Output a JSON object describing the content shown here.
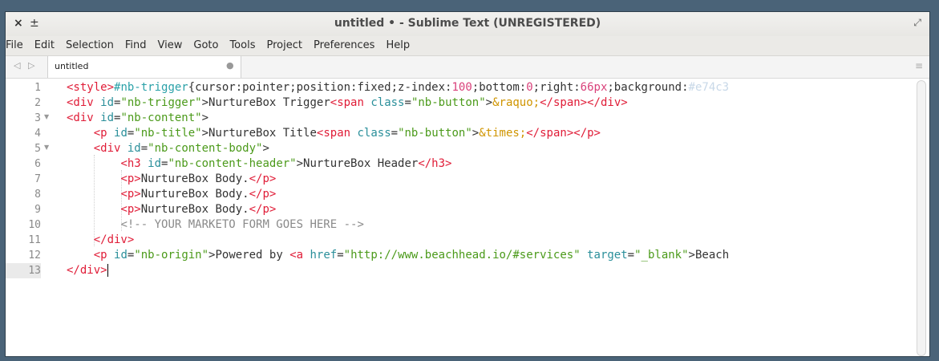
{
  "window": {
    "title": "untitled • - Sublime Text (UNREGISTERED)",
    "close_icon": "×",
    "pin_icon": "±",
    "expand_icon": "⤢"
  },
  "menu": [
    "File",
    "Edit",
    "Selection",
    "Find",
    "View",
    "Goto",
    "Tools",
    "Project",
    "Preferences",
    "Help"
  ],
  "tabs": {
    "arrows": "◁ ▷",
    "active_label": "untitled",
    "dirty_dot": "●",
    "menu_icon": "≡"
  },
  "editor": {
    "line_numbers": [
      "1",
      "2",
      "3",
      "4",
      "5",
      "6",
      "7",
      "8",
      "9",
      "10",
      "11",
      "12",
      "13"
    ],
    "lines": [
      [
        [
          "tag",
          "<style>"
        ],
        [
          "sel",
          "#nb-trigger"
        ],
        [
          "txt",
          "{cursor:pointer;position:fixed;z-index:"
        ],
        [
          "num",
          "100"
        ],
        [
          "txt",
          ";bottom:"
        ],
        [
          "num",
          "0"
        ],
        [
          "txt",
          ";right:"
        ],
        [
          "num",
          "66px"
        ],
        [
          "txt",
          ";background:"
        ],
        [
          "faint",
          "#e74c3"
        ]
      ],
      [
        [
          "tag",
          "<div "
        ],
        [
          "attr",
          "id"
        ],
        [
          "txt",
          "="
        ],
        [
          "str",
          "\"nb-trigger\""
        ],
        [
          "txt",
          ">NurtureBox Trigger"
        ],
        [
          "tag",
          "<span "
        ],
        [
          "attr",
          "class"
        ],
        [
          "txt",
          "="
        ],
        [
          "str",
          "\"nb-button\""
        ],
        [
          "txt",
          ">"
        ],
        [
          "ent",
          "&raquo;"
        ],
        [
          "tag",
          "</span>"
        ],
        [
          "tag",
          "</div>"
        ]
      ],
      [
        [
          "tag",
          "<div "
        ],
        [
          "attr",
          "id"
        ],
        [
          "txt",
          "="
        ],
        [
          "str",
          "\"nb-content\""
        ],
        [
          "txt",
          ">"
        ]
      ],
      [
        [
          "txt",
          "    "
        ],
        [
          "tag",
          "<p "
        ],
        [
          "attr",
          "id"
        ],
        [
          "txt",
          "="
        ],
        [
          "str",
          "\"nb-title\""
        ],
        [
          "txt",
          ">NurtureBox Title"
        ],
        [
          "tag",
          "<span "
        ],
        [
          "attr",
          "class"
        ],
        [
          "txt",
          "="
        ],
        [
          "str",
          "\"nb-button\""
        ],
        [
          "txt",
          ">"
        ],
        [
          "ent",
          "&times;"
        ],
        [
          "tag",
          "</span>"
        ],
        [
          "tag",
          "</p>"
        ]
      ],
      [
        [
          "txt",
          "    "
        ],
        [
          "tag",
          "<div "
        ],
        [
          "attr",
          "id"
        ],
        [
          "txt",
          "="
        ],
        [
          "str",
          "\"nb-content-body\""
        ],
        [
          "txt",
          ">"
        ]
      ],
      [
        [
          "txt",
          "        "
        ],
        [
          "tag",
          "<h3 "
        ],
        [
          "attr",
          "id"
        ],
        [
          "txt",
          "="
        ],
        [
          "str",
          "\"nb-content-header\""
        ],
        [
          "txt",
          ">NurtureBox Header"
        ],
        [
          "tag",
          "</h3>"
        ]
      ],
      [
        [
          "txt",
          "        "
        ],
        [
          "tag",
          "<p>"
        ],
        [
          "txt",
          "NurtureBox Body."
        ],
        [
          "tag",
          "</p>"
        ]
      ],
      [
        [
          "txt",
          "        "
        ],
        [
          "tag",
          "<p>"
        ],
        [
          "txt",
          "NurtureBox Body."
        ],
        [
          "tag",
          "</p>"
        ]
      ],
      [
        [
          "txt",
          "        "
        ],
        [
          "tag",
          "<p>"
        ],
        [
          "txt",
          "NurtureBox Body."
        ],
        [
          "tag",
          "</p>"
        ]
      ],
      [
        [
          "txt",
          "        "
        ],
        [
          "comment",
          "<!-- YOUR MARKETO FORM GOES HERE -->"
        ]
      ],
      [
        [
          "txt",
          "    "
        ],
        [
          "tag",
          "</div>"
        ]
      ],
      [
        [
          "txt",
          "    "
        ],
        [
          "tag",
          "<p "
        ],
        [
          "attr",
          "id"
        ],
        [
          "txt",
          "="
        ],
        [
          "str",
          "\"nb-origin\""
        ],
        [
          "txt",
          ">Powered by "
        ],
        [
          "tag",
          "<a "
        ],
        [
          "attr",
          "href"
        ],
        [
          "txt",
          "="
        ],
        [
          "str",
          "\"http://www.beachhead.io/#services\""
        ],
        [
          "txt",
          " "
        ],
        [
          "attr",
          "target"
        ],
        [
          "txt",
          "="
        ],
        [
          "str",
          "\"_blank\""
        ],
        [
          "txt",
          ">Beach"
        ]
      ],
      [
        [
          "tag",
          "</div>"
        ]
      ]
    ]
  }
}
